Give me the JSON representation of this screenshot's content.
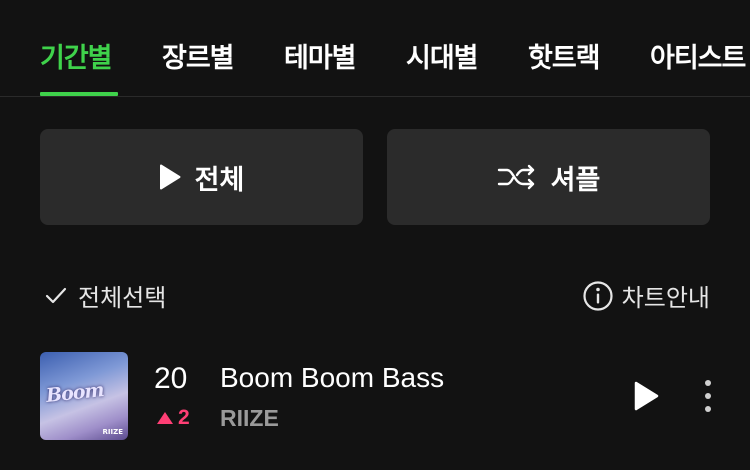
{
  "tabs": [
    {
      "label": "기간별",
      "active": true
    },
    {
      "label": "장르별",
      "active": false
    },
    {
      "label": "테마별",
      "active": false
    },
    {
      "label": "시대별",
      "active": false
    },
    {
      "label": "핫트랙",
      "active": false
    },
    {
      "label": "아티스트",
      "active": false
    }
  ],
  "actions": {
    "play_all_label": "전체",
    "shuffle_label": "셔플"
  },
  "list_controls": {
    "select_all_label": "전체선택",
    "chart_guide_label": "차트안내"
  },
  "songs": [
    {
      "rank": "20",
      "change": "2",
      "change_direction": "up",
      "title": "Boom Boom Bass",
      "artist": "RIIZE",
      "album_art_text": "RIIZE"
    }
  ],
  "colors": {
    "accent": "#3fd24b",
    "rank_up": "#ff3f75",
    "background": "#121212",
    "button_bg": "#2b2b2b",
    "secondary_text": "#9a9a9a"
  },
  "icons": {
    "play": "play-icon",
    "shuffle": "shuffle-icon",
    "check": "check-icon",
    "info": "info-icon",
    "more": "more-vertical-icon",
    "rank_up": "triangle-up-icon"
  }
}
